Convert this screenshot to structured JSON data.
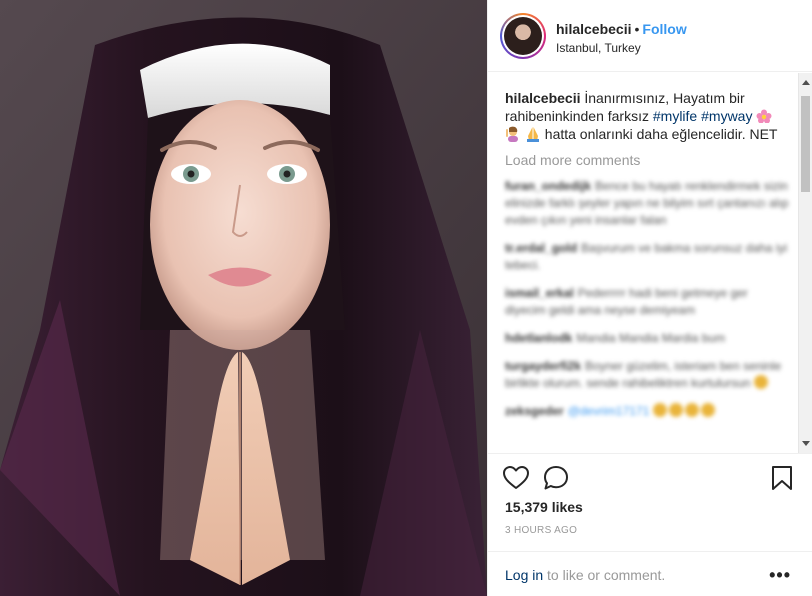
{
  "post": {
    "username": "hilalcebecii",
    "separator": "•",
    "follow_label": "Follow",
    "location": "Istanbul, Turkey"
  },
  "caption": {
    "username": "hilalcebecii",
    "text_part1": "İnanırmısınız, Hayatım bir rahibeninkinden farksız",
    "hashtag1": "#mylife",
    "hashtag2": "#myway",
    "text_part2": "hatta onlarınki daha eğlencelidir. NET"
  },
  "load_more_label": "Load more comments",
  "blurred_comments": [
    {
      "user": "furan_ondedijk",
      "text": "Bence bu hayatı renklendirmek sizin elinizde farklı şeyler yapın ne bilyim sırt çantanızı alıp evden çıkın yeni insanlar falan"
    },
    {
      "user": "tr.erdal_gold",
      "text": "Başvurum ve bakma sorunsuz daha iyi tebeci."
    },
    {
      "user": "ismail_erkal",
      "text": "Pederrrrr hadi beni getmeye ger diyecim geldi ama neyse demiyeam"
    },
    {
      "user": "hdetlanlodk",
      "text": "Mandia Mandia Mardia bum"
    },
    {
      "user": "turgayderfi2k",
      "text": "Boyner güzelim, isteriam ben seninle birlikte olurum. sende rahibeliktren kurtulursun"
    },
    {
      "user": "zeksgeder",
      "text": "@devrim17171"
    }
  ],
  "likes_text": "15,379 likes",
  "timestamp": "3 HOURS AGO",
  "login": {
    "link": "Log in",
    "rest": "to like or comment."
  },
  "more_label": "•••",
  "icons": {
    "like": "heart-icon",
    "comment": "comment-bubble-icon",
    "save": "bookmark-icon",
    "more": "ellipsis-icon"
  },
  "colors": {
    "link_blue": "#3897f0",
    "hashtag": "#003569",
    "muted": "#999999",
    "text": "#262626"
  }
}
